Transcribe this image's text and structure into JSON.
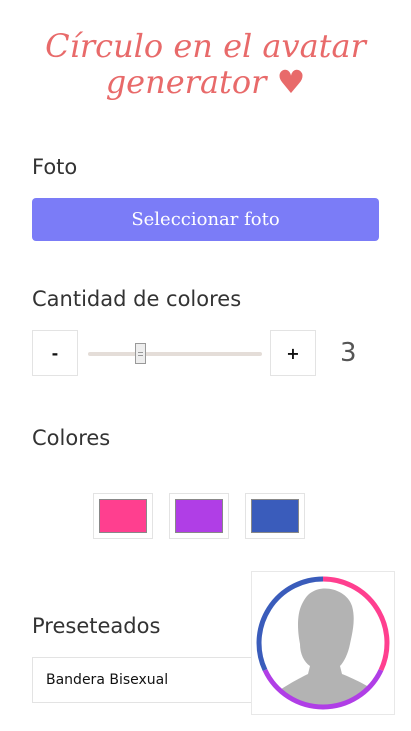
{
  "header": {
    "title_line1": "Círculo en el avatar",
    "title_line2": "generator ♥"
  },
  "photo": {
    "label": "Foto",
    "button_label": "Seleccionar foto"
  },
  "color_count": {
    "label": "Cantidad de colores",
    "decrement_label": "-",
    "increment_label": "+",
    "value": "3",
    "slider_value_fraction": 0.3
  },
  "colors": {
    "label": "Colores",
    "swatches": [
      "#ff3f8f",
      "#b03ee6",
      "#3a5cbb"
    ]
  },
  "presets": {
    "label": "Preseteados",
    "selected": "Bandera Bisexual"
  },
  "avatar": {
    "ring_colors": [
      "#ff3f8f",
      "#b03ee6",
      "#3a5cbb"
    ],
    "silhouette_color": "#b3b3b3"
  }
}
